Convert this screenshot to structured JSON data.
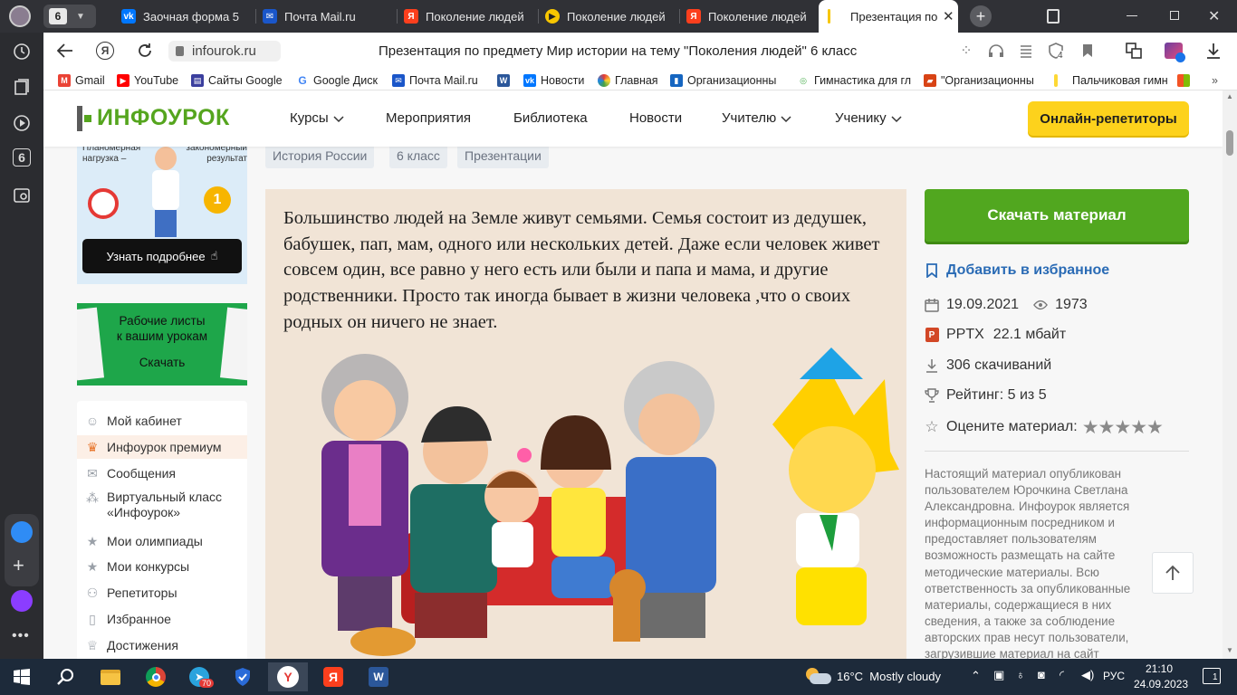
{
  "browser": {
    "tab_count": "6",
    "tabs": [
      {
        "label": "Заочная форма 5"
      },
      {
        "label": "Почта Mail.ru"
      },
      {
        "label": "Поколение людей"
      },
      {
        "label": "Поколение людей"
      },
      {
        "label": "Поколение людей"
      },
      {
        "label": "Презентация по"
      }
    ],
    "url": "infourok.ru",
    "page_title": "Презентация по предмету Мир истории на тему \"Поколения людей\" 6 класс",
    "shield_count": "4",
    "bookmarks": [
      {
        "label": "Gmail"
      },
      {
        "label": "YouTube"
      },
      {
        "label": "Сайты Google"
      },
      {
        "label": "Google Диск"
      },
      {
        "label": "Почта Mail.ru"
      },
      {
        "label": "Новости"
      },
      {
        "label": "Главная"
      },
      {
        "label": "Организационны"
      },
      {
        "label": "Гимнастика для гл"
      },
      {
        "label": "\"Организационны"
      },
      {
        "label": "Пальчиковая гимн"
      }
    ],
    "sidebar_badge": "6"
  },
  "site": {
    "logo": "ИНФОУРОК",
    "nav": [
      "Курсы",
      "Мероприятия",
      "Библиотека",
      "Новости",
      "Учителю",
      "Ученику"
    ],
    "tutor_button": "Онлайн-репетиторы",
    "tags": [
      "История России",
      "6 класс",
      "Презентации"
    ]
  },
  "promo1": {
    "text_left": "Планомерная нагрузка –",
    "text_right": "закономерный результат",
    "button": "Узнать подробнее"
  },
  "promo2": {
    "line1": "Рабочие листы",
    "line2": "к вашим урокам",
    "button": "Скачать"
  },
  "menu": [
    {
      "label": "Мой кабинет"
    },
    {
      "label": "Инфоурок премиум"
    },
    {
      "label": "Сообщения"
    },
    {
      "label": "Виртуальный класс «Инфоурок»"
    },
    {
      "label": "Мои олимпиады"
    },
    {
      "label": "Мои конкурсы"
    },
    {
      "label": "Репетиторы"
    },
    {
      "label": "Избранное"
    },
    {
      "label": "Достижения"
    }
  ],
  "slide": {
    "text": "Большинство людей на Земле живут семьями. Семья состоит из дедушек, бабушек, пап, мам, одного или нескольких детей. Даже если человек живет совсем один, все равно у него есть или были и папа и мама, и другие родственники. Просто так иногда бывает в жизни человека ,что о своих родных он ничего не знает."
  },
  "material": {
    "download_button": "Скачать материал",
    "favorite": "Добавить в избранное",
    "date": "19.09.2021",
    "views": "1973",
    "format": "PPTX",
    "size": "22.1 мбайт",
    "downloads": "306 скачиваний",
    "rating": "Рейтинг: 5 из 5",
    "rate_label": "Оцените материал:",
    "stars": 5,
    "disclaimer": "Настоящий материал опубликован пользователем Юрочкина Светлана Александровна. Инфоурок является информационным посредником и предоставляет пользователям возможность размещать на сайте методические материалы. Всю ответственность за опубликованные материалы, содержащиеся в них сведения, а также за соблюдение авторских прав несут пользователи, загрузившие материал на сайт"
  },
  "taskbar": {
    "telegram_badge": "70",
    "weather": "16°C  Mostly cloudy",
    "lang": "РУС",
    "time": "21:10",
    "date": "24.09.2023",
    "notif": "1"
  },
  "colors": {
    "tabbar": "#303136",
    "download_green": "#51a71f",
    "tutor_yellow": "#fdd21c",
    "taskbar": "#1d2a3a",
    "logo_green": "#55a51e"
  }
}
